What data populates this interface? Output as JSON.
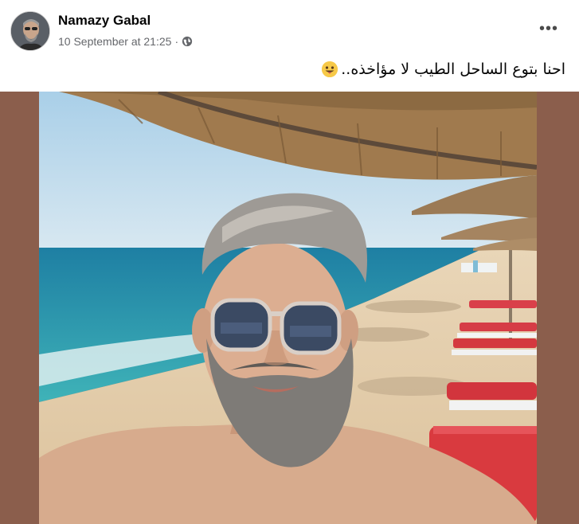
{
  "post": {
    "author": "Namazy Gabal",
    "timestamp": "10 September at 21:25",
    "separator": "·",
    "privacy_icon": "globe-icon",
    "more_options": "•••",
    "caption": "احنا بتوع الساحل الطيب لا مؤاخذه..",
    "caption_emoji": "grinning-tongue-emoji"
  },
  "photo": {
    "subject": "beach-selfie",
    "background_color": "#8b5e4c"
  }
}
